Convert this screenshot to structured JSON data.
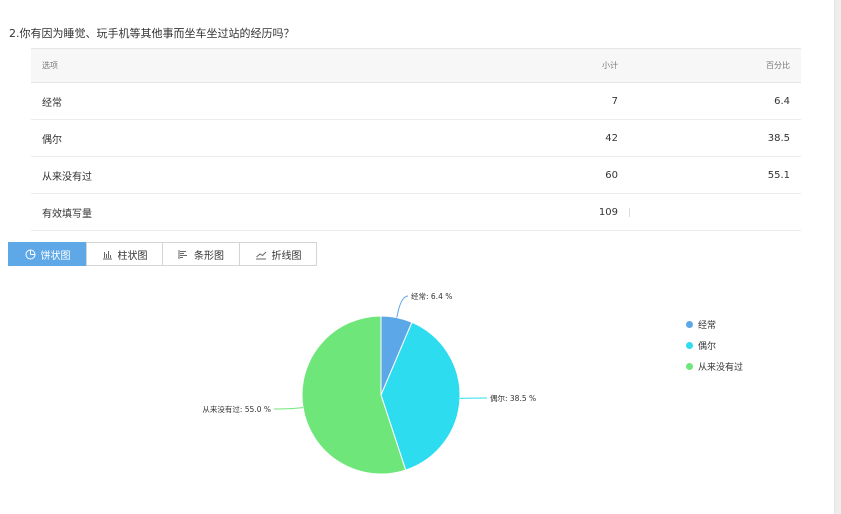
{
  "question": "2.你有因为睡觉、玩手机等其他事而坐车坐过站的经历吗？",
  "table": {
    "headers": [
      "选项",
      "小计",
      "百分比"
    ],
    "rows": [
      {
        "option": "经常",
        "count": "7",
        "percent": "6.4"
      },
      {
        "option": "偶尔",
        "count": "42",
        "percent": "38.5"
      },
      {
        "option": "从来没有过",
        "count": "60",
        "percent": "55.1"
      }
    ],
    "total": {
      "label": "有效填写量",
      "count": "109"
    }
  },
  "tabs": [
    {
      "label": "饼状图",
      "icon": "pie-chart-icon",
      "active": true
    },
    {
      "label": "柱状图",
      "icon": "bar-chart-icon",
      "active": false
    },
    {
      "label": "条形图",
      "icon": "horizontal-bar-icon",
      "active": false
    },
    {
      "label": "折线图",
      "icon": "line-chart-icon",
      "active": false
    }
  ],
  "chart_data": {
    "type": "pie",
    "categories": [
      "经常",
      "偶尔",
      "从来没有过"
    ],
    "values": [
      6.4,
      38.5,
      55.0
    ],
    "labels": [
      "经常: 6.4 %",
      "偶尔: 38.5 %",
      "从来没有过: 55.0 %"
    ],
    "colors": [
      "#5ba7e8",
      "#2edcf0",
      "#6ee67a"
    ],
    "legend_position": "right"
  },
  "colors": {
    "active_tab": "#5fa8e8"
  }
}
